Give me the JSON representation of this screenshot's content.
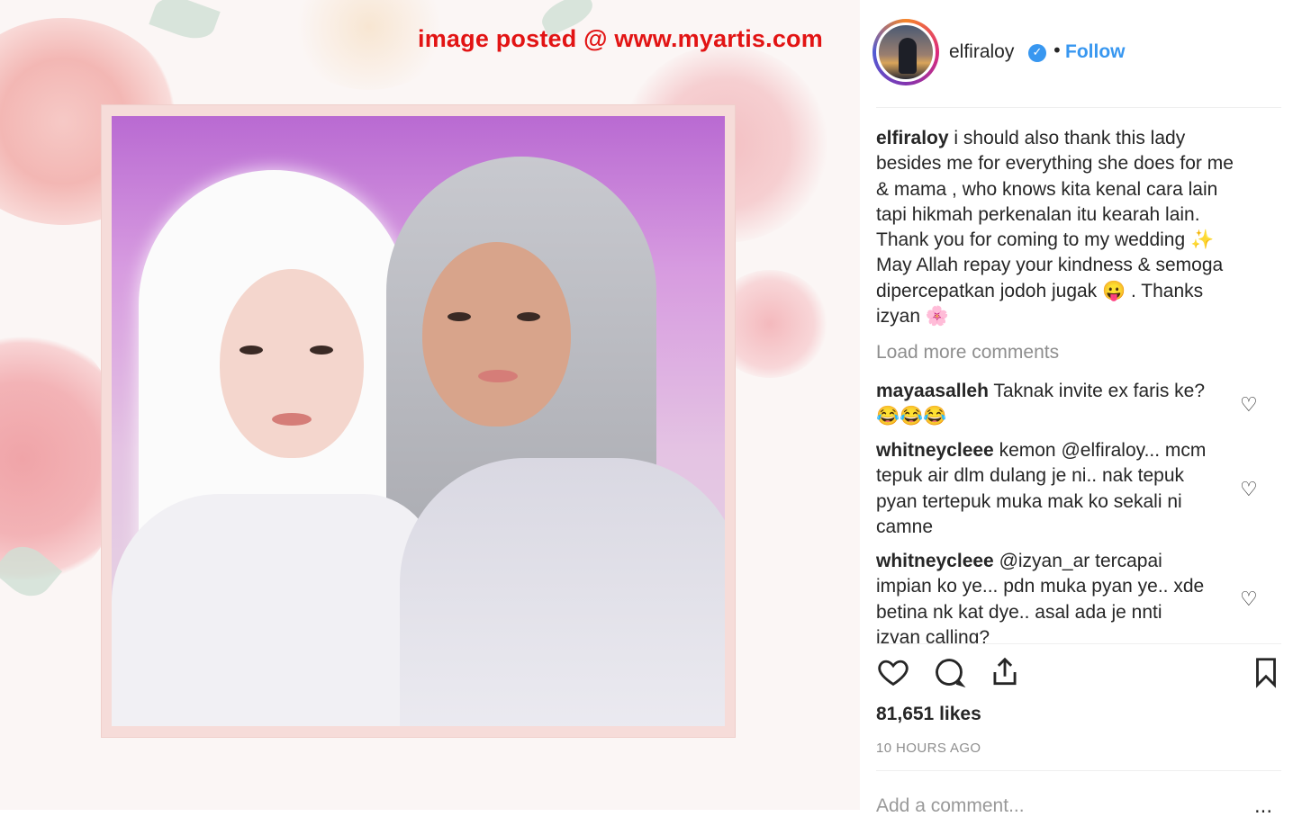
{
  "watermark": "image posted @ www.myartis.com",
  "header": {
    "username": "elfiraloy",
    "verified_icon": "verified-badge-icon",
    "separator": "•",
    "follow_label": "Follow"
  },
  "caption": {
    "user": "elfiraloy",
    "lines": [
      "i should also thank this lady",
      "besides me for everything she does for me",
      "& mama , who knows kita kenal cara lain",
      "tapi hikmah perkenalan itu kearah lain.",
      "Thank you for coming to my wedding ✨",
      "May Allah repay your kindness & semoga",
      "dipercepatkan jodoh jugak 😛 . Thanks",
      "izyan 🌸"
    ]
  },
  "load_more": "Load more comments",
  "comments": [
    {
      "user": "mayaasalleh",
      "lines": [
        "Taknak invite ex faris ke?",
        "😂😂😂"
      ]
    },
    {
      "user": "whitneycleee",
      "lines": [
        "kemon @elfiraloy... mcm",
        "tepuk air dlm dulang je ni.. nak tepuk",
        "pyan tertepuk muka mak ko sekali ni",
        "camne"
      ]
    },
    {
      "user": "whitneycleee",
      "lines": [
        "@izyan_ar tercapai",
        "impian ko ye... pdn muka pyan ye.. xde",
        "betina nk kat dye.. asal ada je nnti",
        "izyan calling?"
      ]
    }
  ],
  "actions": {
    "like_icon": "heart-icon",
    "comment_icon": "comment-bubble-icon",
    "share_icon": "share-icon",
    "save_icon": "bookmark-icon"
  },
  "likes": "81,651 likes",
  "time": "10 HOURS AGO",
  "add_comment": {
    "placeholder": "Add a comment...",
    "post_label": "..."
  }
}
